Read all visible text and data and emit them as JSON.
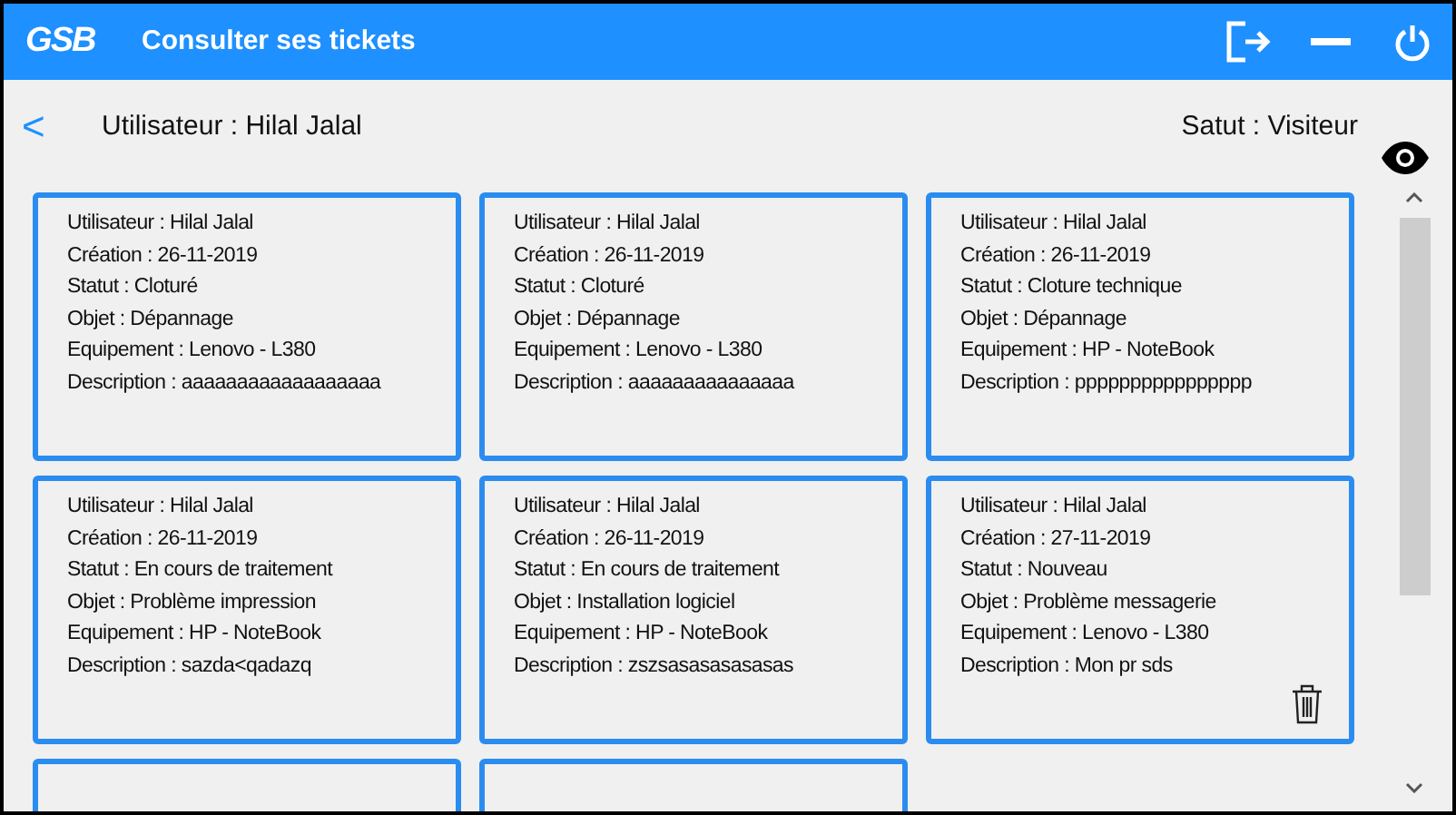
{
  "window": {
    "logo": "GSB",
    "title": "Consulter ses tickets"
  },
  "header": {
    "back": "<",
    "user": "Utilisateur : Hilal Jalal",
    "role": "Satut : Visiteur"
  },
  "tickets": [
    {
      "lines": [
        "Utilisateur : Hilal Jalal",
        "Création : 26-11-2019",
        "Statut : Cloturé",
        "Objet : Dépannage",
        "Equipement : Lenovo - L380",
        "Description : aaaaaaaaaaaaaaaaaa"
      ],
      "deletable": false
    },
    {
      "lines": [
        "Utilisateur : Hilal Jalal",
        "Création : 26-11-2019",
        "Statut : Cloturé",
        "Objet : Dépannage",
        "Equipement : Lenovo - L380",
        "Description : aaaaaaaaaaaaaaa"
      ],
      "deletable": false
    },
    {
      "lines": [
        "Utilisateur : Hilal Jalal",
        "Création : 26-11-2019",
        "Statut : Cloture technique",
        "Objet : Dépannage",
        "Equipement : HP - NoteBook",
        "Description : pppppppppppppppp"
      ],
      "deletable": false
    },
    {
      "lines": [
        "Utilisateur : Hilal Jalal",
        "Création : 26-11-2019",
        "Statut : En cours de traitement",
        "Objet : Problème impression",
        "Equipement : HP - NoteBook",
        "Description : sazda<qadazq"
      ],
      "deletable": false
    },
    {
      "lines": [
        "Utilisateur : Hilal Jalal",
        "Création : 26-11-2019",
        "Statut : En cours de traitement",
        "Objet : Installation logiciel",
        "Equipement : HP - NoteBook",
        "Description : zszsasasasasasas"
      ],
      "deletable": false
    },
    {
      "lines": [
        "Utilisateur : Hilal Jalal",
        "Création : 27-11-2019",
        "Statut : Nouveau",
        "Objet : Problème messagerie",
        "Equipement : Lenovo - L380",
        "Description : Mon pr sds"
      ],
      "deletable": true
    }
  ]
}
